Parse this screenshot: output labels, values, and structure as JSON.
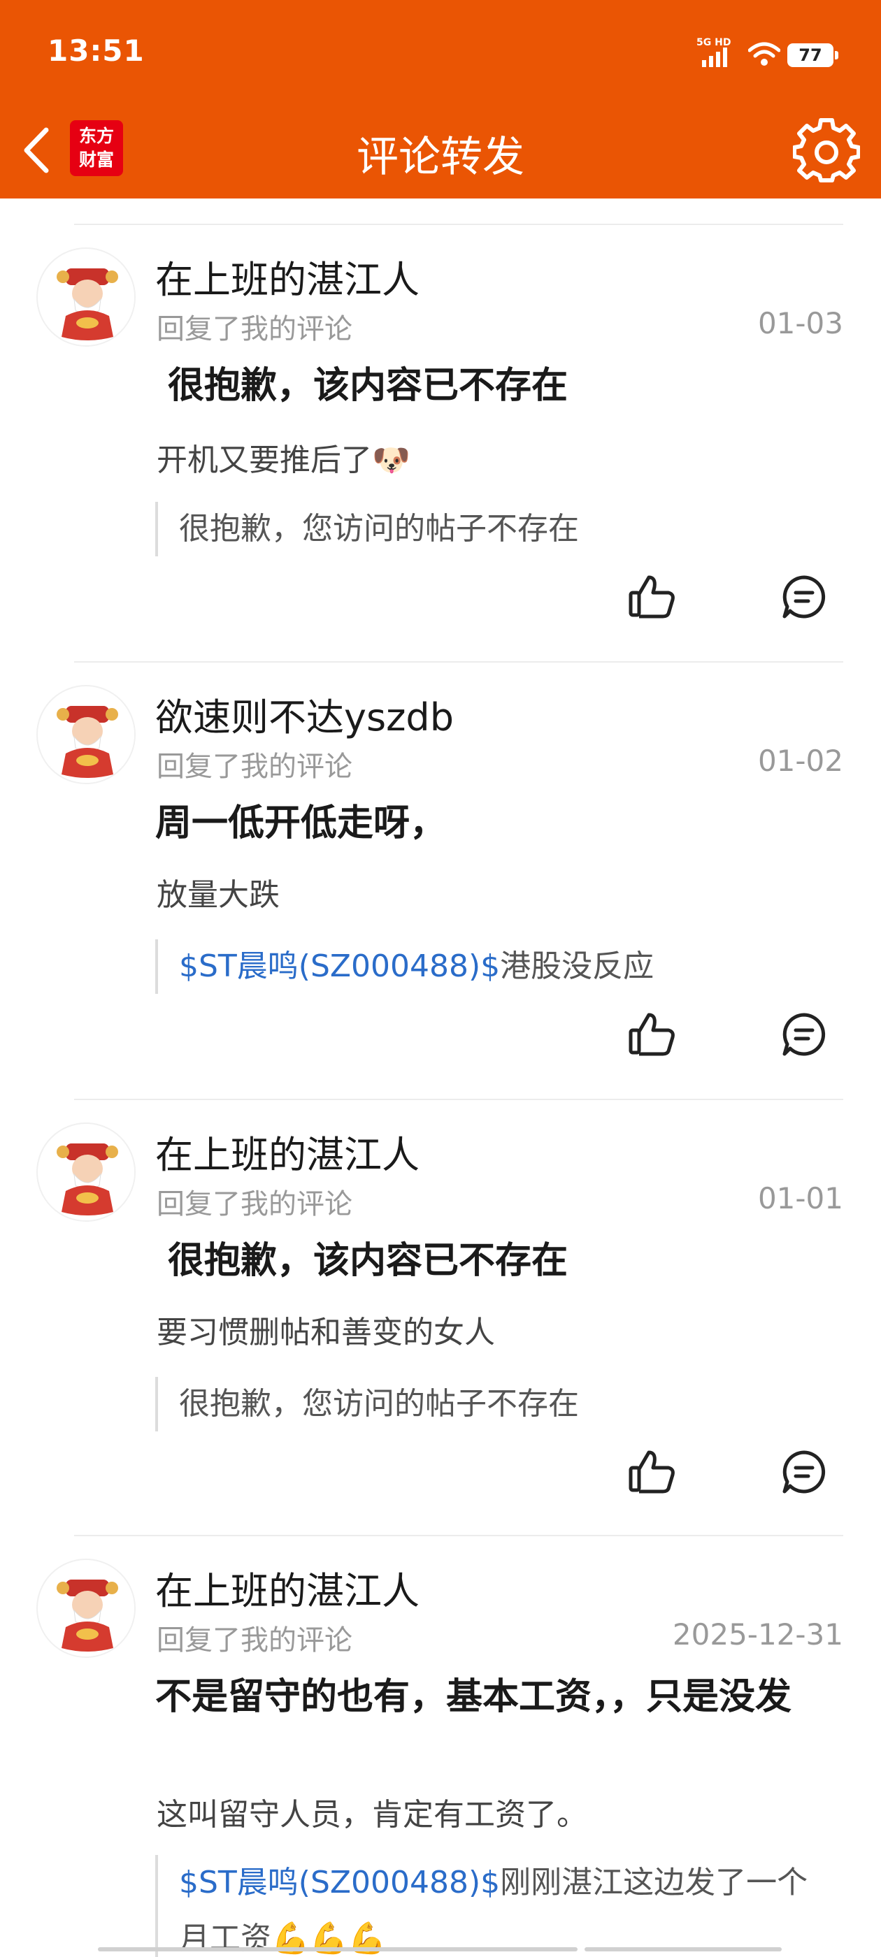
{
  "status_bar": {
    "time": "13:51",
    "network": "5G HD",
    "battery": "77"
  },
  "header": {
    "logo_line1": "东方",
    "logo_line2": "财富",
    "title": "评论转发"
  },
  "feed": [
    {
      "username": "在上班的湛江人",
      "action": "回复了我的评论",
      "date": "01-03",
      "main": "很抱歉，该内容已不存在",
      "reply": "开机又要推后了",
      "reply_emoji": "🐶",
      "quote_stock": "",
      "quote_text": "很抱歉，您访问的帖子不存在"
    },
    {
      "username": "欲速则不达yszdb",
      "action": "回复了我的评论",
      "date": "01-02",
      "main": "周一低开低走呀，",
      "reply": "放量大跌",
      "reply_emoji": "",
      "quote_stock": "$ST晨鸣(SZ000488)$",
      "quote_text": "港股没反应"
    },
    {
      "username": "在上班的湛江人",
      "action": "回复了我的评论",
      "date": "01-01",
      "main": "很抱歉，该内容已不存在",
      "reply": "要习惯删帖和善变的女人",
      "reply_emoji": "",
      "quote_stock": "",
      "quote_text": "很抱歉，您访问的帖子不存在"
    },
    {
      "username": "在上班的湛江人",
      "action": "回复了我的评论",
      "date": "2025-12-31",
      "main": "不是留守的也有，基本工资，，只是没发",
      "reply": "这叫留守人员，肯定有工资了。",
      "reply_emoji": "",
      "quote_stock": "$ST晨鸣(SZ000488)$",
      "quote_text": "刚刚湛江这边发了一个月工资💪💪💪"
    }
  ],
  "icons": {
    "back": "chevron-left-icon",
    "settings": "gear-icon",
    "like": "thumbs-up-icon",
    "comment": "comment-bubble-icon",
    "avatar": "fortune-god-avatar"
  },
  "colors": {
    "brand": "#EA5504",
    "logo": "#E60012",
    "stock_link": "#2A6CC9"
  }
}
